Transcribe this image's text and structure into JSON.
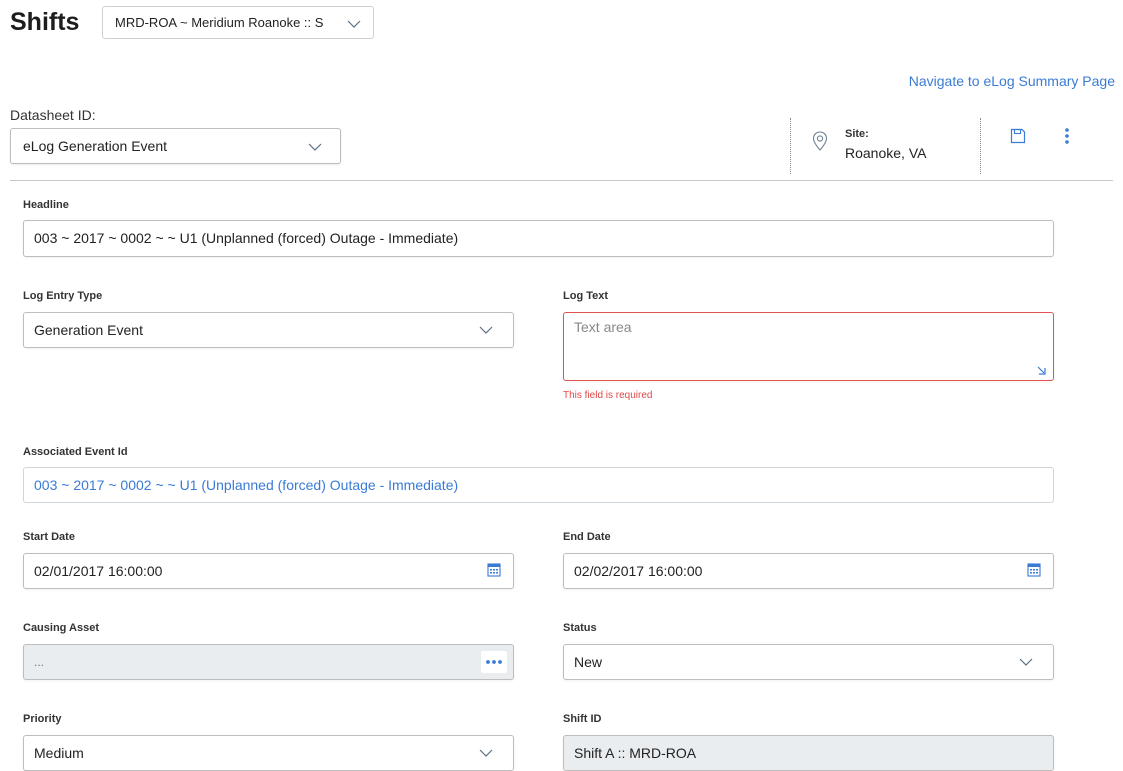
{
  "header": {
    "title": "Shifts",
    "asset_selector_value": "MRD-ROA ~ Meridium Roanoke :: S",
    "navigate_link": "Navigate to eLog Summary Page"
  },
  "datasheet": {
    "label": "Datasheet ID:",
    "value": "eLog Generation Event"
  },
  "site": {
    "label": "Site:",
    "value": "Roanoke, VA"
  },
  "form": {
    "headline": {
      "label": "Headline",
      "value": "003 ~ 2017 ~ 0002 ~  ~ U1 (Unplanned (forced) Outage - Immediate)"
    },
    "log_entry_type": {
      "label": "Log Entry Type",
      "value": "Generation Event"
    },
    "log_text": {
      "label": "Log Text",
      "placeholder": "Text area",
      "error": "This field is required"
    },
    "associated_event_id": {
      "label": "Associated Event Id",
      "value": "003 ~ 2017 ~ 0002 ~ ~ U1 (Unplanned (forced) Outage - Immediate)"
    },
    "start_date": {
      "label": "Start Date",
      "value": "02/01/2017 16:00:00"
    },
    "end_date": {
      "label": "End Date",
      "value": "02/02/2017 16:00:00"
    },
    "causing_asset": {
      "label": "Causing Asset",
      "value": "..."
    },
    "status": {
      "label": "Status",
      "value": "New"
    },
    "priority": {
      "label": "Priority",
      "value": "Medium"
    },
    "shift_id": {
      "label": "Shift ID",
      "value": "Shift A :: MRD-ROA"
    }
  },
  "colors": {
    "accent": "#3a7bd5",
    "error": "#e15353",
    "readonly_bg": "#e9edf0"
  }
}
